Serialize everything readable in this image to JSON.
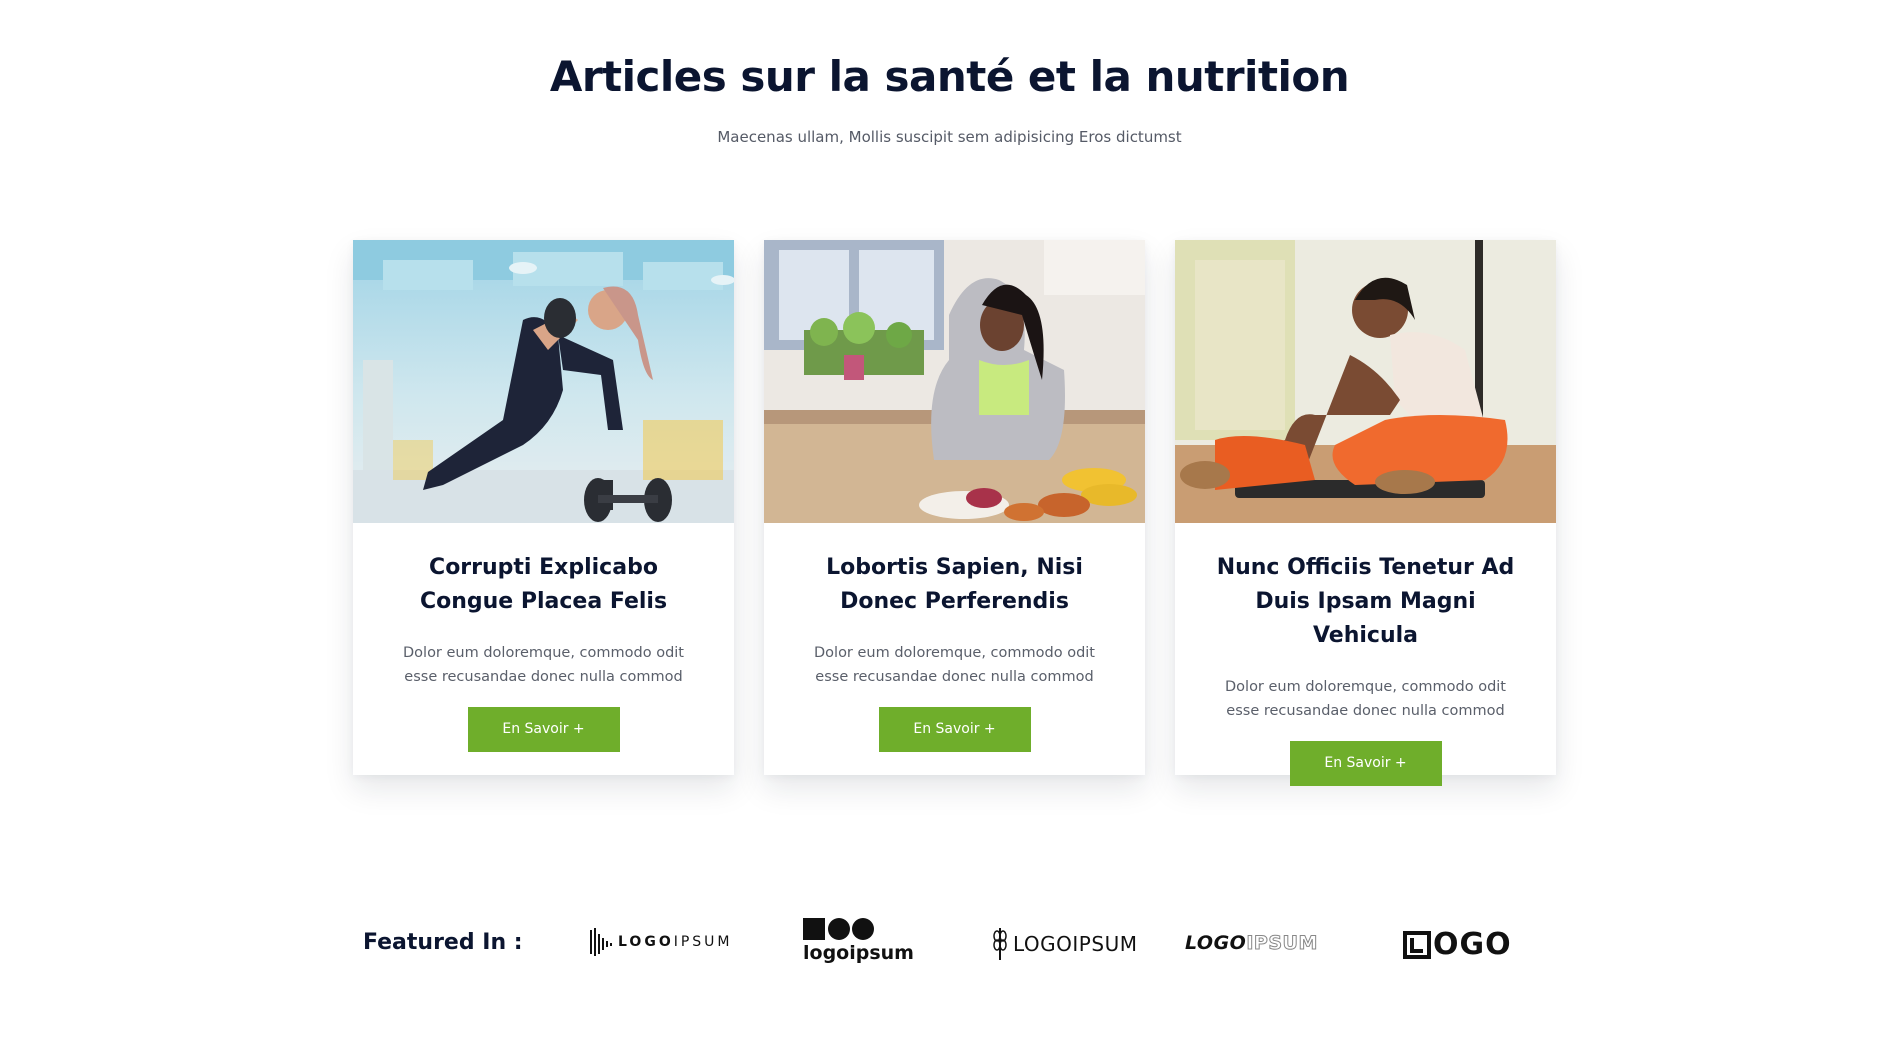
{
  "section": {
    "title": "Articles sur la santé et la nutrition",
    "subtitle": "Maecenas ullam, Mollis suscipit sem adipisicing Eros dictumst"
  },
  "cards": [
    {
      "image": "woman-dumbbell-gym-photo",
      "title": "Corrupti Explicabo Congue Placea Felis",
      "text": "Dolor eum doloremque, commodo odit esse recusandae donec nulla commod",
      "button": "En Savoir +"
    },
    {
      "image": "woman-cooking-kitchen-photo",
      "title": "Lobortis Sapien, Nisi Donec Perferendis",
      "text": "Dolor eum doloremque, commodo odit esse recusandae donec nulla commod",
      "button": "En Savoir +"
    },
    {
      "image": "woman-stretching-mat-photo",
      "title": "Nunc Officiis Tenetur Ad Duis Ipsam Magni Vehicula",
      "text": "Dolor eum doloremque, commodo odit esse recusandae donec nulla commod",
      "button": "En Savoir +"
    }
  ],
  "colors": {
    "accent": "#6fae2b",
    "heading": "#0b1530",
    "body_text": "#5a5f6a"
  },
  "featured": {
    "label": "Featured In :",
    "logos": [
      {
        "icon": "soundwave-icon",
        "text_bold": "LOGO",
        "text_light": "IPSUM"
      },
      {
        "icon": "square-circles-icon",
        "text": "logoipsum"
      },
      {
        "icon": "wheat-icon",
        "text": "LOGOIPSUM"
      },
      {
        "text_bold": "LOGO",
        "text_light": "IPSUM"
      },
      {
        "icon": "l-square-icon",
        "text": "OGO"
      }
    ]
  }
}
